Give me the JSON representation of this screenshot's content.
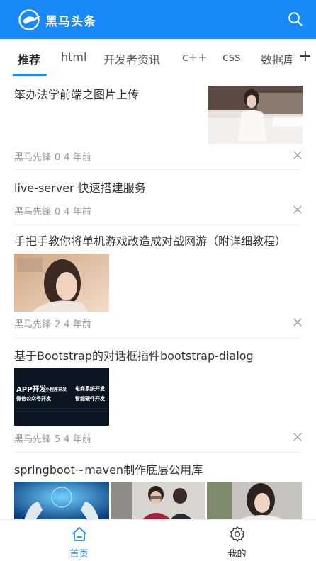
{
  "header": {
    "logo_text": "黑马头条",
    "search_icon": "search-icon",
    "background": "#1989fa"
  },
  "tabs": {
    "items": [
      "推荐",
      "html",
      "开发者资讯",
      "c++",
      "css",
      "数据库"
    ],
    "active": "推荐",
    "add_icon": "plus-icon"
  },
  "articles": [
    {
      "title": "笨办法学前端之图片上传",
      "author": "黑马先锋",
      "comments": "0",
      "time": "4 年前",
      "images": 1
    },
    {
      "title": "live-server 快速搭建服务",
      "author": "黑马先锋",
      "comments": "0",
      "time": "4 年前",
      "images": 0
    },
    {
      "title": "手把手教你将单机游戏改造成对战网游（附详细教程）",
      "author": "黑马先锋",
      "comments": "2",
      "time": "4 年前",
      "images": 1
    },
    {
      "title": "基于Bootstrap的对话框插件bootstrap-dialog",
      "author": "黑马先锋",
      "comments": "5",
      "time": "4 年前",
      "images": 1,
      "thumb_lines": [
        "APP开发",
        "小程序开发",
        "电商系统开发",
        "微信公众号开发",
        "智能硬件开发"
      ]
    },
    {
      "title": "springboot~maven制作底层公用库",
      "images": 3
    }
  ],
  "tabbar": {
    "items": [
      {
        "label": "首页",
        "icon": "home-icon",
        "active": true
      },
      {
        "label": "我的",
        "icon": "gear-icon",
        "active": false
      }
    ],
    "active_color": "#1989fa"
  }
}
